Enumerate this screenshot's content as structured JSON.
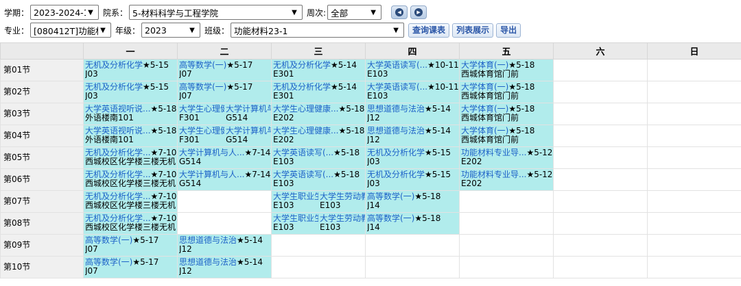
{
  "filters": {
    "term_label": "学期：",
    "term_value": "2023-2024-1",
    "dept_label": "院系：",
    "dept_value": "5-材料科学与工程学院",
    "week_label": "周次:",
    "week_value": "全部",
    "major_label": "专业：",
    "major_value": "[080412T]功能权",
    "grade_label": "年级：",
    "grade_value": "2023",
    "class_label": "班级：",
    "class_value": "功能材料23-1",
    "query_button": "查询课表",
    "list_button": "列表展示",
    "export_button": "导出"
  },
  "days": [
    "一",
    "二",
    "三",
    "四",
    "五",
    "六",
    "日"
  ],
  "periods": [
    "第01节",
    "第02节",
    "第03节",
    "第04节",
    "第05节",
    "第06节",
    "第07节",
    "第08节",
    "第09节",
    "第10节"
  ],
  "grid": [
    [
      {
        "name": "无机及分析化学",
        "weeks": "★5-15",
        "room": "J03"
      },
      {
        "name": "高等数学(一)",
        "weeks": "★5-17",
        "room": "J07"
      },
      {
        "name": "无机及分析化学",
        "weeks": "★5-14",
        "room": "E301"
      },
      {
        "name": "大学英语读写(...",
        "weeks": "★10-11",
        "room": "E103"
      },
      {
        "name": "大学体育(一)",
        "weeks": "★5-18",
        "room": "西城体育馆门前"
      },
      null,
      null
    ],
    [
      {
        "name": "无机及分析化学",
        "weeks": "★5-15",
        "room": "J03"
      },
      {
        "name": "高等数学(一)",
        "weeks": "★5-17",
        "room": "J07"
      },
      {
        "name": "无机及分析化学",
        "weeks": "★5-14",
        "room": "E301"
      },
      {
        "name": "大学英语读写(...",
        "weeks": "★10-11",
        "room": "E103"
      },
      {
        "name": "大学体育(一)",
        "weeks": "★5-18",
        "room": "西城体育馆门前"
      },
      null,
      null
    ],
    [
      {
        "name": "大学英语视听说...",
        "weeks": "★5-18",
        "room": "外语楼南101"
      },
      {
        "split": [
          {
            "name": "大学生心理健",
            "weeks": "",
            "room": "F301"
          },
          {
            "name": "大学计算机与",
            "weeks": "",
            "room": "G514"
          }
        ]
      },
      {
        "name": "大学生心理健康...",
        "weeks": "★5-18",
        "room": "E202"
      },
      {
        "name": "思想道德与法治",
        "weeks": "★5-14",
        "room": "J12"
      },
      {
        "name": "大学体育(一)",
        "weeks": "★5-18",
        "room": "西城体育馆门前"
      },
      null,
      null
    ],
    [
      {
        "name": "大学英语视听说...",
        "weeks": "★5-18",
        "room": "外语楼南101"
      },
      {
        "split": [
          {
            "name": "大学生心理健",
            "weeks": "",
            "room": "F301"
          },
          {
            "name": "大学计算机与",
            "weeks": "",
            "room": "G514"
          }
        ]
      },
      {
        "name": "大学生心理健康...",
        "weeks": "★5-18",
        "room": "E202"
      },
      {
        "name": "思想道德与法治",
        "weeks": "★5-14",
        "room": "J12"
      },
      {
        "name": "大学体育(一)",
        "weeks": "★5-18",
        "room": "西城体育馆门前"
      },
      null,
      null
    ],
    [
      {
        "name": "无机及分析化学...",
        "weeks": "★7-10,",
        "room": "西城校区化学楼三楼无机"
      },
      {
        "name": "大学计算机与人...",
        "weeks": "★7-14",
        "room": "G514"
      },
      {
        "name": "大学英语读写(...",
        "weeks": "★5-18",
        "room": "E103"
      },
      {
        "name": "无机及分析化学",
        "weeks": "★5-15",
        "room": "J03"
      },
      {
        "name": "功能材料专业导...",
        "weeks": "★5-12",
        "room": "E202"
      },
      null,
      null
    ],
    [
      {
        "name": "无机及分析化学...",
        "weeks": "★7-10,",
        "room": "西城校区化学楼三楼无机"
      },
      {
        "name": "大学计算机与人...",
        "weeks": "★7-14",
        "room": "G514"
      },
      {
        "name": "大学英语读写(...",
        "weeks": "★5-18",
        "room": "E103"
      },
      {
        "name": "无机及分析化学",
        "weeks": "★5-15",
        "room": "J03"
      },
      {
        "name": "功能材料专业导...",
        "weeks": "★5-12",
        "room": "E202"
      },
      null,
      null
    ],
    [
      {
        "name": "无机及分析化学...",
        "weeks": "★7-10,",
        "room": "西城校区化学楼三楼无机"
      },
      null,
      {
        "split": [
          {
            "name": "大学生职业生",
            "weeks": "",
            "room": "E103"
          },
          {
            "name": "大学生劳动教",
            "weeks": "",
            "room": "E103"
          }
        ]
      },
      {
        "name": "高等数学(一)",
        "weeks": "★5-18",
        "room": "J14"
      },
      null,
      null,
      null
    ],
    [
      {
        "name": "无机及分析化学...",
        "weeks": "★7-10,",
        "room": "西城校区化学楼三楼无机"
      },
      null,
      {
        "split": [
          {
            "name": "大学生职业生",
            "weeks": "",
            "room": "E103"
          },
          {
            "name": "大学生劳动教",
            "weeks": "",
            "room": "E103"
          }
        ]
      },
      {
        "name": "高等数学(一)",
        "weeks": "★5-18",
        "room": "J14"
      },
      null,
      null,
      null
    ],
    [
      {
        "name": "高等数学(一)",
        "weeks": "★5-17",
        "room": "J07"
      },
      {
        "name": "思想道德与法治",
        "weeks": "★5-14",
        "room": "J12"
      },
      null,
      null,
      null,
      null,
      null
    ],
    [
      {
        "name": "高等数学(一)",
        "weeks": "★5-17",
        "room": "J07"
      },
      {
        "name": "思想道德与法治",
        "weeks": "★5-14",
        "room": "J12"
      },
      null,
      null,
      null,
      null,
      null
    ]
  ],
  "colors": {
    "course_cell_bg": "#b1ecec",
    "course_name": "#1d62c8",
    "header_bg": "#eaeaea"
  }
}
